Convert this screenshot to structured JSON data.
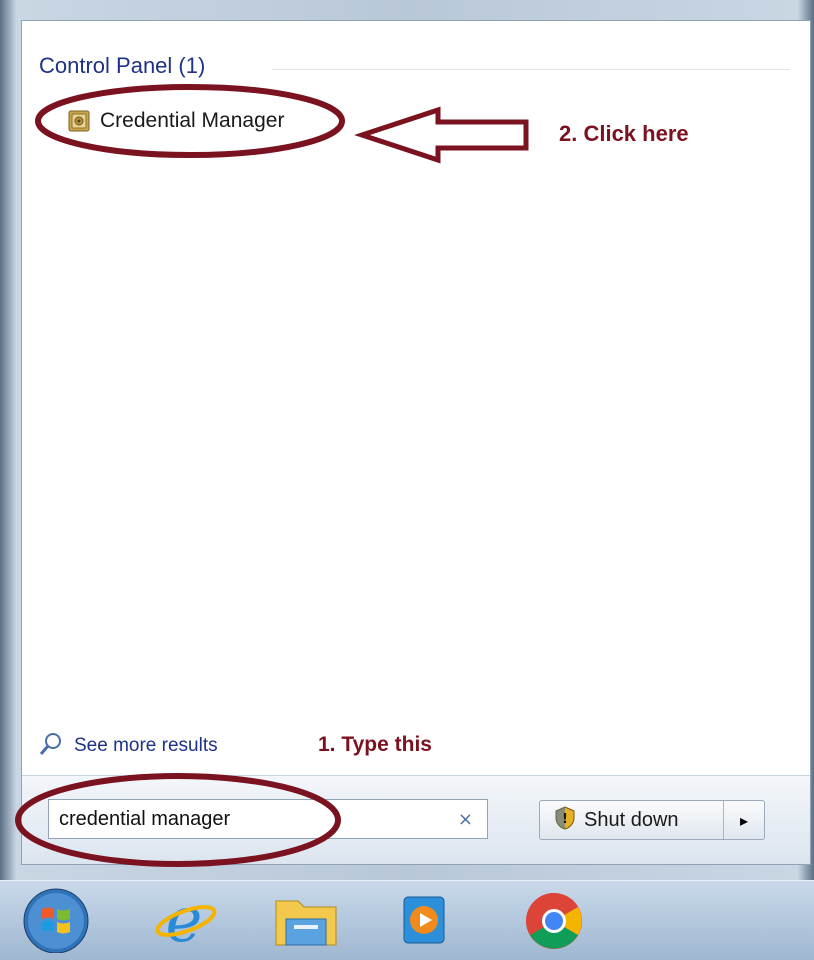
{
  "start_menu": {
    "group_header": "Control Panel (1)",
    "results": [
      {
        "label": "Credential Manager",
        "icon": "credential-manager-icon"
      }
    ],
    "see_more": "See more results",
    "search": {
      "value": "credential manager",
      "clear_icon": "×"
    },
    "shutdown": {
      "label": "Shut down",
      "arrow": "▸"
    }
  },
  "annotations": {
    "step2": "2. Click here",
    "step1": "1. Type this",
    "color": "#7b1220"
  },
  "taskbar": {
    "items": [
      {
        "name": "windows-start-orb"
      },
      {
        "name": "internet-explorer-icon"
      },
      {
        "name": "file-explorer-icon"
      },
      {
        "name": "media-player-icon"
      },
      {
        "name": "chrome-icon"
      }
    ]
  },
  "colors": {
    "link_blue": "#1e3287",
    "panel_bg": "#ffffff",
    "annotation": "#7b1220"
  }
}
